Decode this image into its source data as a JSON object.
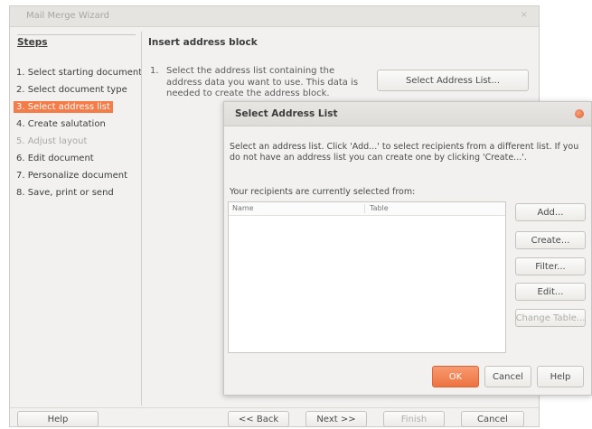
{
  "wizard": {
    "title": "Mail Merge Wizard",
    "close_glyph": "×",
    "steps_heading": "Steps",
    "steps": [
      {
        "label": "1. Select starting document",
        "state": "normal"
      },
      {
        "label": "2. Select document type",
        "state": "normal"
      },
      {
        "label": "3. Select address list",
        "state": "active"
      },
      {
        "label": "4. Create salutation",
        "state": "normal"
      },
      {
        "label": "5. Adjust layout",
        "state": "disabled"
      },
      {
        "label": "6. Edit document",
        "state": "normal"
      },
      {
        "label": "7. Personalize document",
        "state": "normal"
      },
      {
        "label": "8. Save, print or send",
        "state": "normal"
      }
    ],
    "main": {
      "heading": "Insert address block",
      "item_number": "1.",
      "item_text": "Select the address list containing the address data you want to use. This data is needed to create the address block.",
      "select_list_button": "Select Address List..."
    },
    "footer": {
      "help": "Help",
      "back": "<< Back",
      "next": "Next >>",
      "finish": "Finish",
      "cancel": "Cancel"
    }
  },
  "dialog": {
    "title": "Select Address List",
    "description": "Select an address list. Click 'Add...' to select recipients from a different list. If you do not have an address list you can create one by clicking 'Create...'.",
    "selected_from_label": "Your recipients are currently selected from:",
    "columns": [
      "Name",
      "Table"
    ],
    "rows": [],
    "buttons": {
      "add": "Add...",
      "create": "Create...",
      "filter": "Filter...",
      "edit": "Edit...",
      "change_table": "Change Table..."
    },
    "footer": {
      "ok": "OK",
      "cancel": "Cancel",
      "help": "Help"
    }
  },
  "colors": {
    "accent": "#f47c48",
    "window_bg": "#f2f1f0",
    "disabled_text": "#aaa8a5"
  }
}
